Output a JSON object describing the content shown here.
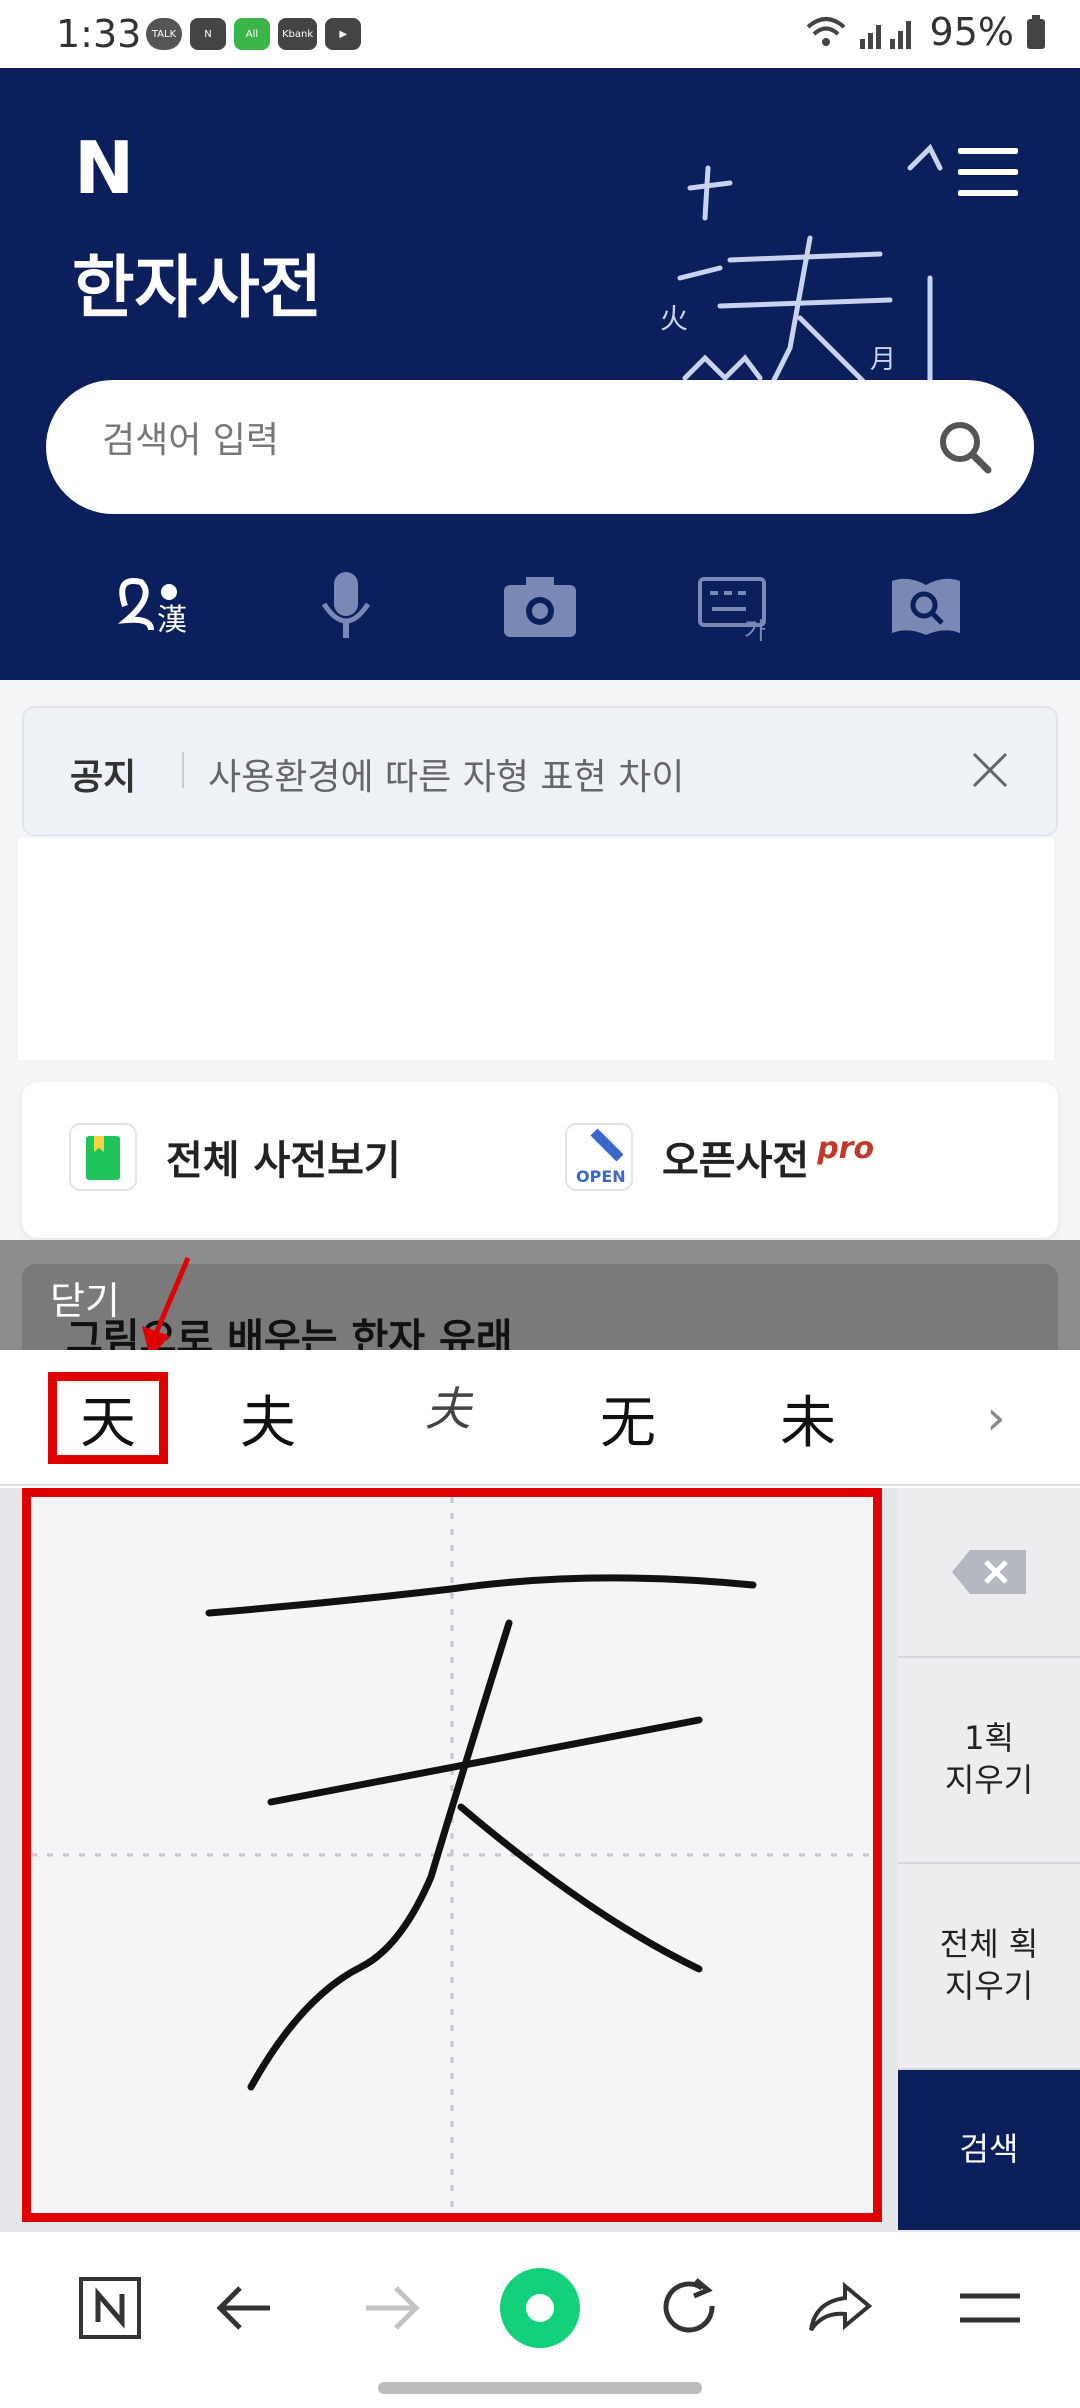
{
  "status_bar": {
    "time": "1:33",
    "app_icons": [
      "TALK",
      "N",
      "All",
      "Kbank",
      "▶"
    ],
    "battery": "95%"
  },
  "header": {
    "logo": "N",
    "title": "한자사전",
    "search_placeholder": "검색어 입력",
    "tools": [
      "handwriting-hanja",
      "voice",
      "camera",
      "keyboard",
      "scan-book"
    ]
  },
  "notice": {
    "tag": "공지",
    "text": "사용환경에 따른 자형 표현 차이"
  },
  "dict_links": {
    "all": "전체 사전보기",
    "open": "오픈사전",
    "open_badge": "pro",
    "open_icon_text": "OPEN"
  },
  "overlay": {
    "close_label": "닫기",
    "under_title": "그림으로 배우는 한자 유래"
  },
  "candidates": {
    "items": [
      "天",
      "夫",
      "夫",
      "无",
      "未"
    ],
    "selected_index": 0,
    "next": "›"
  },
  "side_buttons": {
    "undo_stroke": "1획\n지우기",
    "clear_all": "전체 획\n지우기",
    "search": "검색"
  },
  "colors": {
    "header_bg": "#0b1f5c",
    "highlight": "#e00000",
    "search_btn_bg": "#0b1f5c"
  }
}
